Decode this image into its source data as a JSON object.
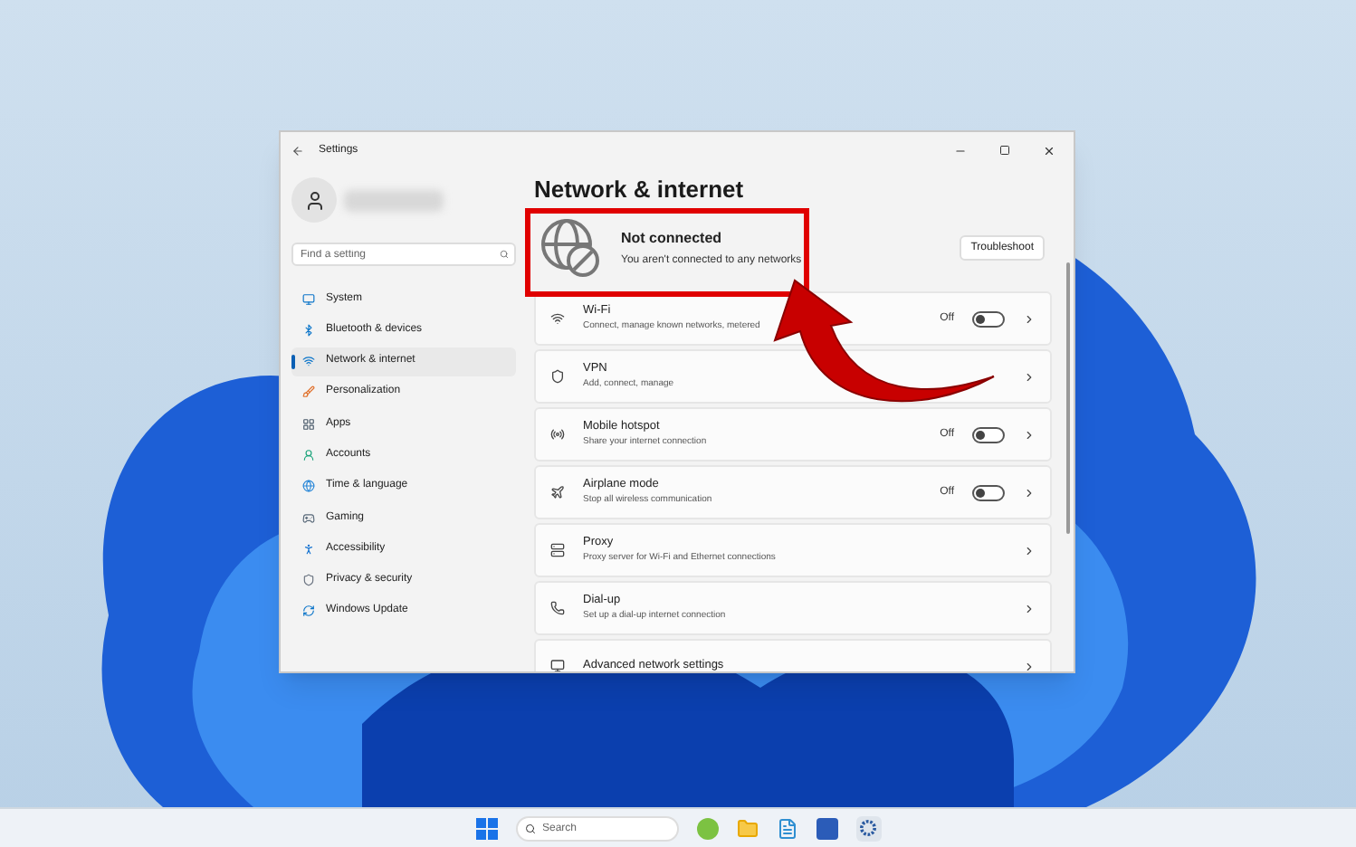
{
  "window": {
    "title": "Settings"
  },
  "search": {
    "placeholder": "Find a setting"
  },
  "sidebar": {
    "items": [
      {
        "label": "System",
        "selected": false
      },
      {
        "label": "Bluetooth & devices",
        "selected": false
      },
      {
        "label": "Network & internet",
        "selected": true
      },
      {
        "label": "Personalization",
        "selected": false
      },
      {
        "label": "Apps",
        "selected": false
      },
      {
        "label": "Accounts",
        "selected": false
      },
      {
        "label": "Time & language",
        "selected": false
      },
      {
        "label": "Gaming",
        "selected": false
      },
      {
        "label": "Accessibility",
        "selected": false
      },
      {
        "label": "Privacy & security",
        "selected": false
      },
      {
        "label": "Windows Update",
        "selected": false
      }
    ]
  },
  "page_title": "Network & internet",
  "status": {
    "title": "Not connected",
    "subtitle": "You aren't connected to any networks",
    "button": "Troubleshoot"
  },
  "rows": [
    {
      "title": "Wi-Fi",
      "subtitle": "Connect, manage known networks, metered",
      "kind": "toggle",
      "state_label": "Off",
      "on": false
    },
    {
      "title": "VPN",
      "subtitle": "Add, connect, manage",
      "kind": "link"
    },
    {
      "title": "Mobile hotspot",
      "subtitle": "Share your internet connection",
      "kind": "toggle",
      "state_label": "Off",
      "on": false
    },
    {
      "title": "Airplane mode",
      "subtitle": "Stop all wireless communication",
      "kind": "toggle",
      "state_label": "Off",
      "on": false
    },
    {
      "title": "Proxy",
      "subtitle": "Proxy server for Wi-Fi and Ethernet connections",
      "kind": "link"
    },
    {
      "title": "Dial-up",
      "subtitle": "Set up a dial-up internet connection",
      "kind": "link"
    },
    {
      "title": "Advanced network settings",
      "kind": "link"
    }
  ],
  "taskbar": {
    "search_placeholder": "Search"
  }
}
